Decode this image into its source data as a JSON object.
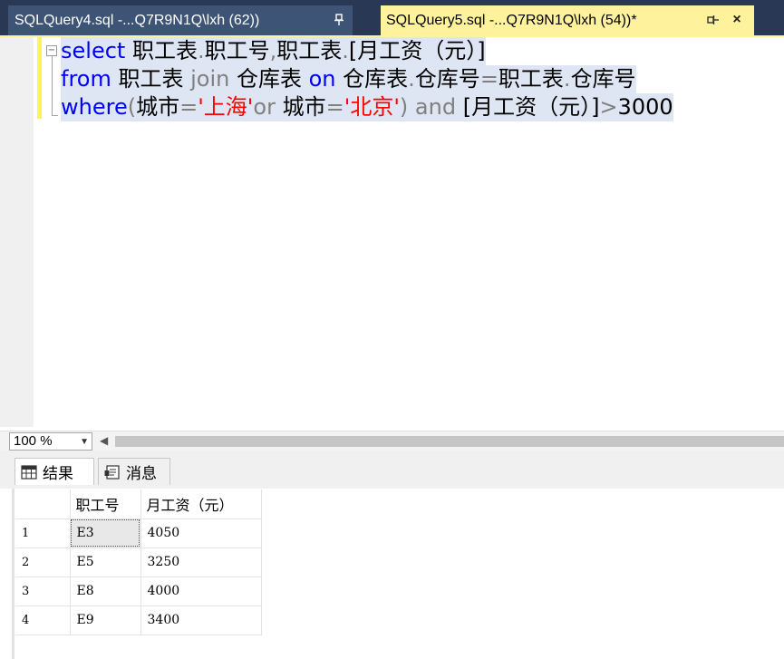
{
  "tabs": [
    {
      "title": "SQLQuery4.sql -...Q7R9N1Q\\lxh (62))",
      "pin": "pin-icon",
      "active": false
    },
    {
      "title": "SQLQuery5.sql -...Q7R9N1Q\\lxh (54))*",
      "pin": "pin-icon",
      "close": "×",
      "active": true
    }
  ],
  "editor": {
    "lines": [
      [
        {
          "t": "select",
          "c": "kw"
        },
        {
          "t": " 职工表",
          "c": "blk"
        },
        {
          "t": ".",
          "c": "gray"
        },
        {
          "t": "职工号",
          "c": "blk"
        },
        {
          "t": ",",
          "c": "gray"
        },
        {
          "t": "职工表",
          "c": "blk"
        },
        {
          "t": ".",
          "c": "gray"
        },
        {
          "t": "[月工资（元）]",
          "c": "blk"
        }
      ],
      [
        {
          "t": "from",
          "c": "kw"
        },
        {
          "t": " 职工表 ",
          "c": "blk"
        },
        {
          "t": "join",
          "c": "gray"
        },
        {
          "t": " 仓库表 ",
          "c": "blk"
        },
        {
          "t": "on",
          "c": "kw"
        },
        {
          "t": " 仓库表",
          "c": "blk"
        },
        {
          "t": ".",
          "c": "gray"
        },
        {
          "t": "仓库号",
          "c": "blk"
        },
        {
          "t": "=",
          "c": "gray"
        },
        {
          "t": "职工表",
          "c": "blk"
        },
        {
          "t": ".",
          "c": "gray"
        },
        {
          "t": "仓库号",
          "c": "blk"
        }
      ],
      [
        {
          "t": "where",
          "c": "kw"
        },
        {
          "t": "(",
          "c": "gray"
        },
        {
          "t": "城市",
          "c": "blk"
        },
        {
          "t": "=",
          "c": "gray"
        },
        {
          "t": "'上海'",
          "c": "str"
        },
        {
          "t": "or",
          "c": "gray"
        },
        {
          "t": " 城市",
          "c": "blk"
        },
        {
          "t": "=",
          "c": "gray"
        },
        {
          "t": "'北京'",
          "c": "str"
        },
        {
          "t": ") ",
          "c": "gray"
        },
        {
          "t": "and",
          "c": "gray"
        },
        {
          "t": " [月工资（元）]",
          "c": "blk"
        },
        {
          "t": ">",
          "c": "gray"
        },
        {
          "t": "3000",
          "c": "blk"
        }
      ]
    ]
  },
  "zoom": {
    "value": "100 %"
  },
  "results_tabs": {
    "results_label": "结果",
    "messages_label": "消息"
  },
  "grid": {
    "columns": [
      "职工号",
      "月工资（元）"
    ],
    "rows": [
      {
        "n": "1",
        "cells": [
          "E3",
          "4050"
        ]
      },
      {
        "n": "2",
        "cells": [
          "E5",
          "3250"
        ]
      },
      {
        "n": "3",
        "cells": [
          "E8",
          "4000"
        ]
      },
      {
        "n": "4",
        "cells": [
          "E9",
          "3400"
        ]
      }
    ]
  },
  "colors": {
    "tabstrip_bg": "#293955",
    "active_tab_bg": "#fff29d",
    "keyword": "#0000ff",
    "string": "#ff0000",
    "operator": "#808080",
    "selection": "#dde6f2"
  }
}
